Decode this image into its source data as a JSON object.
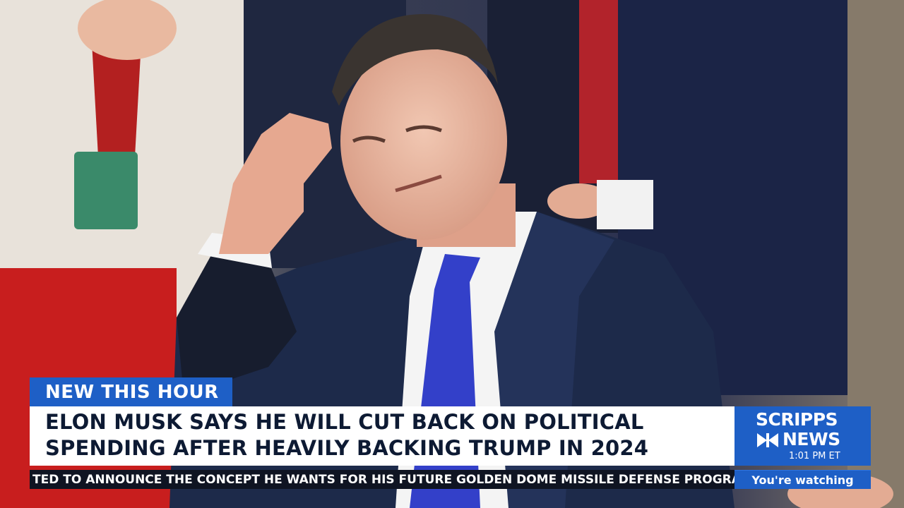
{
  "lower_third": {
    "tag": "NEW THIS HOUR",
    "headline_line1": "ELON MUSK SAYS HE WILL CUT BACK ON POLITICAL",
    "headline_line2": "SPENDING AFTER HEAVILY BACKING TRUMP IN 2024",
    "ticker": "TED TO ANNOUNCE THE CONCEPT HE WANTS FOR HIS FUTURE GOLDEN DOME MISSILE DEFENSE PROGRAM"
  },
  "brand": {
    "name_line1": "SCRIPPS",
    "name_line2": "NEWS",
    "time": "1:01 PM ET",
    "watching": "You're watching",
    "icon": "scripps-lighthouse-icon"
  },
  "colors": {
    "brand_blue": "#1e5fc6",
    "headline_text": "#0d1a33",
    "ticker_bg": "#0f1422",
    "suit": "#1d2a4a",
    "tie": "#3340c9"
  }
}
